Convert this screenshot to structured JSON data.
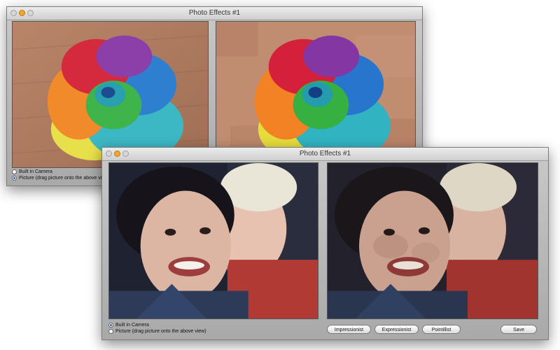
{
  "colors": {
    "window_bg": "#b8b8b8",
    "accent_radio": "#2a5bd7"
  },
  "back_window": {
    "title": "Photo Effects #1",
    "source": {
      "built_in_camera_label": "Built in Camera",
      "picture_label": "Picture (drag picture onto the above view)",
      "selected": "picture"
    },
    "left_view_content": "rainbow rose photo",
    "right_view_content": "painted rainbow rose"
  },
  "front_window": {
    "title": "Photo Effects #1",
    "source": {
      "built_in_camera_label": "Built in Camera",
      "picture_label": "Picture (drag picture onto the above view)",
      "selected": "built_in_camera"
    },
    "buttons": {
      "impressionist": "Impressionist",
      "expressionist": "Expressionist",
      "pointillist": "Pointillist",
      "save": "Save"
    },
    "left_view_content": "two children photo",
    "right_view_content": "painted children photo"
  }
}
